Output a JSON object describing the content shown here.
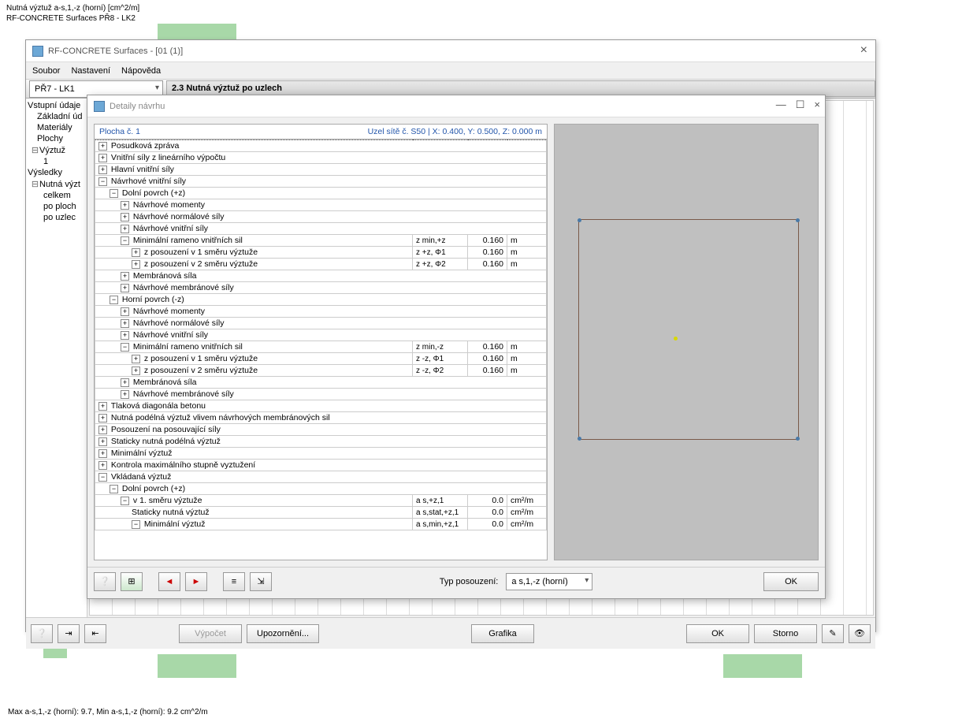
{
  "top": {
    "line1": "Nutná výztuž a-s,1,-z (horní) [cm^2/m]",
    "line2": "RF-CONCRETE Surfaces PŘ8 - LK2"
  },
  "main": {
    "title": "RF-CONCRETE Surfaces - [01 (1)]",
    "menu": {
      "file": "Soubor",
      "settings": "Nastavení",
      "help": "Nápověda"
    },
    "combo": "PŘ7 - LK1",
    "section": "2.3 Nutná výztuž po uzlech"
  },
  "sidebar": {
    "items": [
      "Vstupní údaje",
      "Základní úd",
      "Materiály",
      "Plochy",
      "Výztuž",
      "1",
      "Výsledky",
      "Nutná výzt",
      "celkem",
      "po ploch",
      "po uzlec"
    ]
  },
  "dialog": {
    "title": "Detaily návrhu",
    "header_left": "Plocha č. 1",
    "header_right": "Uzel sítě č. S50  |  X: 0.400, Y: 0.500, Z: 0.000 m",
    "type_label": "Typ posouzení:",
    "type_val": "a s,1,-z (horní)",
    "ok": "OK"
  },
  "rows": [
    {
      "lvl": 0,
      "exp": "+",
      "label": "Posudková zpráva",
      "sel": true
    },
    {
      "lvl": 0,
      "exp": "+",
      "label": "Vnitřní síly z lineárního výpočtu"
    },
    {
      "lvl": 0,
      "exp": "+",
      "label": "Hlavní vnitřní síly"
    },
    {
      "lvl": 0,
      "exp": "−",
      "label": "Návrhové vnitřní síly"
    },
    {
      "lvl": 1,
      "exp": "−",
      "label": "Dolní povrch (+z)"
    },
    {
      "lvl": 2,
      "exp": "+",
      "label": "Návrhové momenty"
    },
    {
      "lvl": 2,
      "exp": "+",
      "label": "Návrhové normálové síly"
    },
    {
      "lvl": 2,
      "exp": "+",
      "label": "Návrhové vnitřní síly"
    },
    {
      "lvl": 2,
      "exp": "−",
      "label": "Minimální rameno vnitřních sil",
      "sym": "z min,+z",
      "val": "0.160",
      "unit": "m"
    },
    {
      "lvl": 3,
      "exp": "+",
      "label": "z posouzení v 1 směru výztuže",
      "sym": "z +z, Φ1",
      "val": "0.160",
      "unit": "m"
    },
    {
      "lvl": 3,
      "exp": "+",
      "label": "z posouzení v 2 směru výztuže",
      "sym": "z +z, Φ2",
      "val": "0.160",
      "unit": "m"
    },
    {
      "lvl": 2,
      "exp": "+",
      "label": "Membránová síla"
    },
    {
      "lvl": 2,
      "exp": "+",
      "label": "Návrhové membránové síly"
    },
    {
      "lvl": 1,
      "exp": "−",
      "label": "Horní povrch (-z)"
    },
    {
      "lvl": 2,
      "exp": "+",
      "label": "Návrhové momenty"
    },
    {
      "lvl": 2,
      "exp": "+",
      "label": "Návrhové normálové síly"
    },
    {
      "lvl": 2,
      "exp": "+",
      "label": "Návrhové vnitřní síly"
    },
    {
      "lvl": 2,
      "exp": "−",
      "label": "Minimální rameno vnitřních sil",
      "sym": "z min,-z",
      "val": "0.160",
      "unit": "m"
    },
    {
      "lvl": 3,
      "exp": "+",
      "label": "z posouzení v 1 směru výztuže",
      "sym": "z -z, Φ1",
      "val": "0.160",
      "unit": "m"
    },
    {
      "lvl": 3,
      "exp": "+",
      "label": "z posouzení v 2 směru výztuže",
      "sym": "z -z, Φ2",
      "val": "0.160",
      "unit": "m"
    },
    {
      "lvl": 2,
      "exp": "+",
      "label": "Membránová síla"
    },
    {
      "lvl": 2,
      "exp": "+",
      "label": "Návrhové membránové síly"
    },
    {
      "lvl": 0,
      "exp": "+",
      "label": "Tlaková diagonála betonu"
    },
    {
      "lvl": 0,
      "exp": "+",
      "label": "Nutná podélná výztuž vlivem návrhových membránových sil"
    },
    {
      "lvl": 0,
      "exp": "+",
      "label": "Posouzení na posouvající síly"
    },
    {
      "lvl": 0,
      "exp": "+",
      "label": "Staticky nutná podélná výztuž"
    },
    {
      "lvl": 0,
      "exp": "+",
      "label": "Minimální výztuž"
    },
    {
      "lvl": 0,
      "exp": "+",
      "label": "Kontrola maximálního stupně vyztužení"
    },
    {
      "lvl": 0,
      "exp": "−",
      "label": "Vkládaná výztuž"
    },
    {
      "lvl": 1,
      "exp": "−",
      "label": "Dolní povrch (+z)"
    },
    {
      "lvl": 2,
      "exp": "−",
      "label": "v 1. směru výztuže",
      "sym": "a s,+z,1",
      "val": "0.0",
      "unit": "cm²/m"
    },
    {
      "lvl": 3,
      "exp": "",
      "label": "Staticky nutná výztuž",
      "sym": "a s,stat,+z,1",
      "val": "0.0",
      "unit": "cm²/m"
    },
    {
      "lvl": 3,
      "exp": "−",
      "label": "Minimální výztuž",
      "sym": "a s,min,+z,1",
      "val": "0.0",
      "unit": "cm²/m"
    }
  ],
  "buttons": {
    "calc": "Výpočet",
    "warn": "Upozornění...",
    "gfx": "Grafika",
    "ok": "OK",
    "cancel": "Storno"
  },
  "status": "Max a-s,1,-z (horní): 9.7, Min a-s,1,-z (horní): 9.2 cm^2/m"
}
